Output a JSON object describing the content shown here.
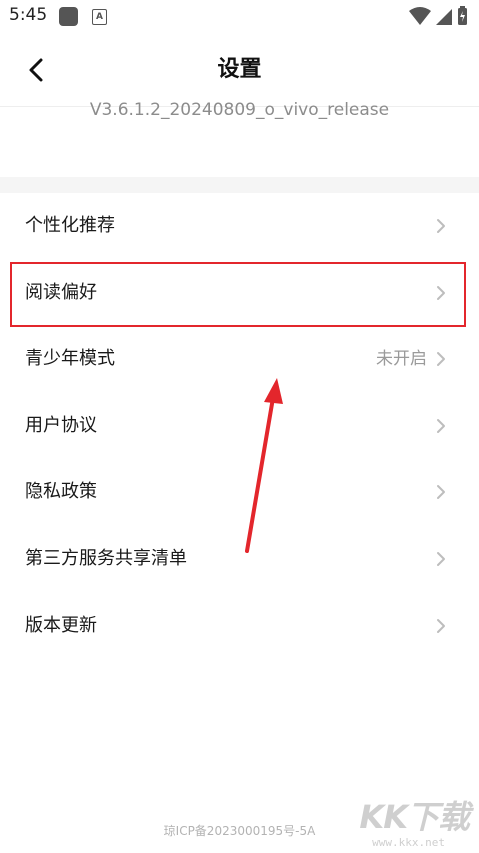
{
  "status_bar": {
    "time": "5:45",
    "notification_icons": [
      "dark-square-icon",
      "app-a-icon"
    ],
    "system_icons": [
      "wifi-icon",
      "signal-icon",
      "battery-icon"
    ]
  },
  "header": {
    "title": "设置",
    "back_icon": "chevron-left-icon"
  },
  "version": "V3.6.1.2_20240809_o_vivo_release",
  "settings": {
    "items": [
      {
        "label": "个性化推荐",
        "value": ""
      },
      {
        "label": "阅读偏好",
        "value": ""
      },
      {
        "label": "青少年模式",
        "value": "未开启"
      },
      {
        "label": "用户协议",
        "value": ""
      },
      {
        "label": "隐私政策",
        "value": ""
      },
      {
        "label": "第三方服务共享清单",
        "value": ""
      },
      {
        "label": "版本更新",
        "value": ""
      }
    ],
    "highlighted_item": "阅读偏好"
  },
  "footer": {
    "icp": "琼ICP备2023000195号-5A"
  },
  "watermark": {
    "text": "KK下载",
    "url": "www.kkx.net"
  },
  "colors": {
    "highlight": "#e3262c",
    "arrow": "#e3262c",
    "secondary_text": "#9a9a9a",
    "section_gap": "#f5f5f5"
  }
}
